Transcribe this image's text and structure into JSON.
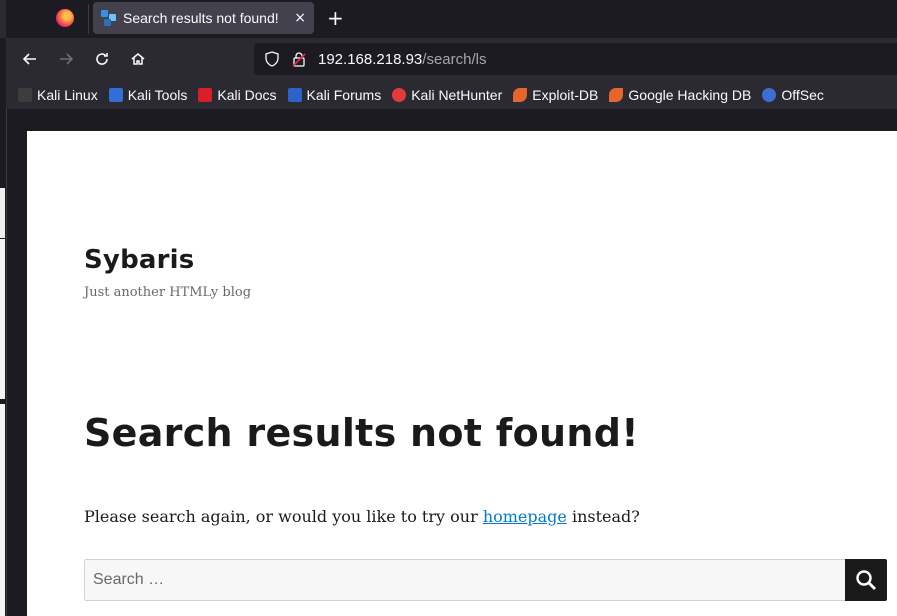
{
  "browser": {
    "tab": {
      "title": "Search results not found!",
      "close_glyph": "×"
    },
    "new_tab_glyph": "+",
    "address": {
      "host": "192.168.218.93",
      "path": "/search/ls"
    },
    "bookmarks": [
      {
        "label": "Kali Linux",
        "icon": "kali-dragon-icon",
        "color": "#3d3d3d"
      },
      {
        "label": "Kali Tools",
        "icon": "kali-tools-icon",
        "color": "#2f6fd6"
      },
      {
        "label": "Kali Docs",
        "icon": "kali-docs-icon",
        "color": "#d71f2a"
      },
      {
        "label": "Kali Forums",
        "icon": "kali-forums-icon",
        "color": "#2d62c9"
      },
      {
        "label": "Kali NetHunter",
        "icon": "kali-nethunter-icon",
        "color": "#e03a3a"
      },
      {
        "label": "Exploit-DB",
        "icon": "exploit-db-icon",
        "color": "#e5652b"
      },
      {
        "label": "Google Hacking DB",
        "icon": "ghdb-icon",
        "color": "#e5652b"
      },
      {
        "label": "OffSec",
        "icon": "offsec-icon",
        "color": "#3c6fd1"
      }
    ]
  },
  "site": {
    "title": "Sybaris",
    "description": "Just another HTMLy blog"
  },
  "main": {
    "heading": "Search results not found!",
    "notice_before": "Please search again, or would you like to try our ",
    "notice_link": "homepage",
    "notice_after": " instead?",
    "search_placeholder": "Search …"
  },
  "colors": {
    "link": "#007acc",
    "search_button": "#1a1a1a"
  }
}
